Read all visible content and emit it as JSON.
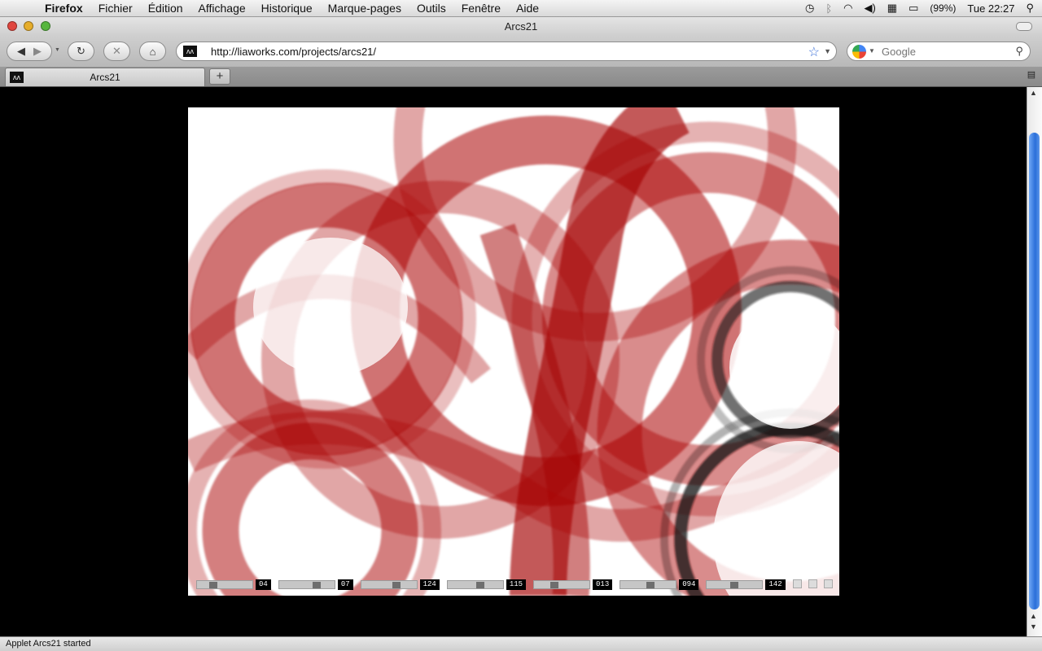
{
  "menubar": {
    "app_name": "Firefox",
    "items": [
      "Fichier",
      "Édition",
      "Affichage",
      "Historique",
      "Marque-pages",
      "Outils",
      "Fenêtre",
      "Aide"
    ],
    "battery": "(99%)",
    "clock": "Tue 22:27"
  },
  "window": {
    "title": "Arcs21"
  },
  "toolbar": {
    "url": "http://liaworks.com/projects/arcs21/",
    "search_placeholder": "Google"
  },
  "tab": {
    "title": "Arcs21",
    "new_tab_label": "+"
  },
  "applet": {
    "controls": [
      {
        "value": "04",
        "level": 0.25
      },
      {
        "value": "07",
        "level": 0.7
      },
      {
        "value": "124",
        "level": 0.65
      },
      {
        "value": "115",
        "level": 0.6
      },
      {
        "value": "013",
        "level": 0.35
      },
      {
        "value": "094",
        "level": 0.55
      },
      {
        "value": "142",
        "level": 0.5
      }
    ],
    "colors": {
      "primary_arcs": "#aa0000",
      "secondary_arcs": "#111111",
      "background": "#ffffff"
    }
  },
  "statusbar": {
    "text": "Applet Arcs21 started"
  }
}
